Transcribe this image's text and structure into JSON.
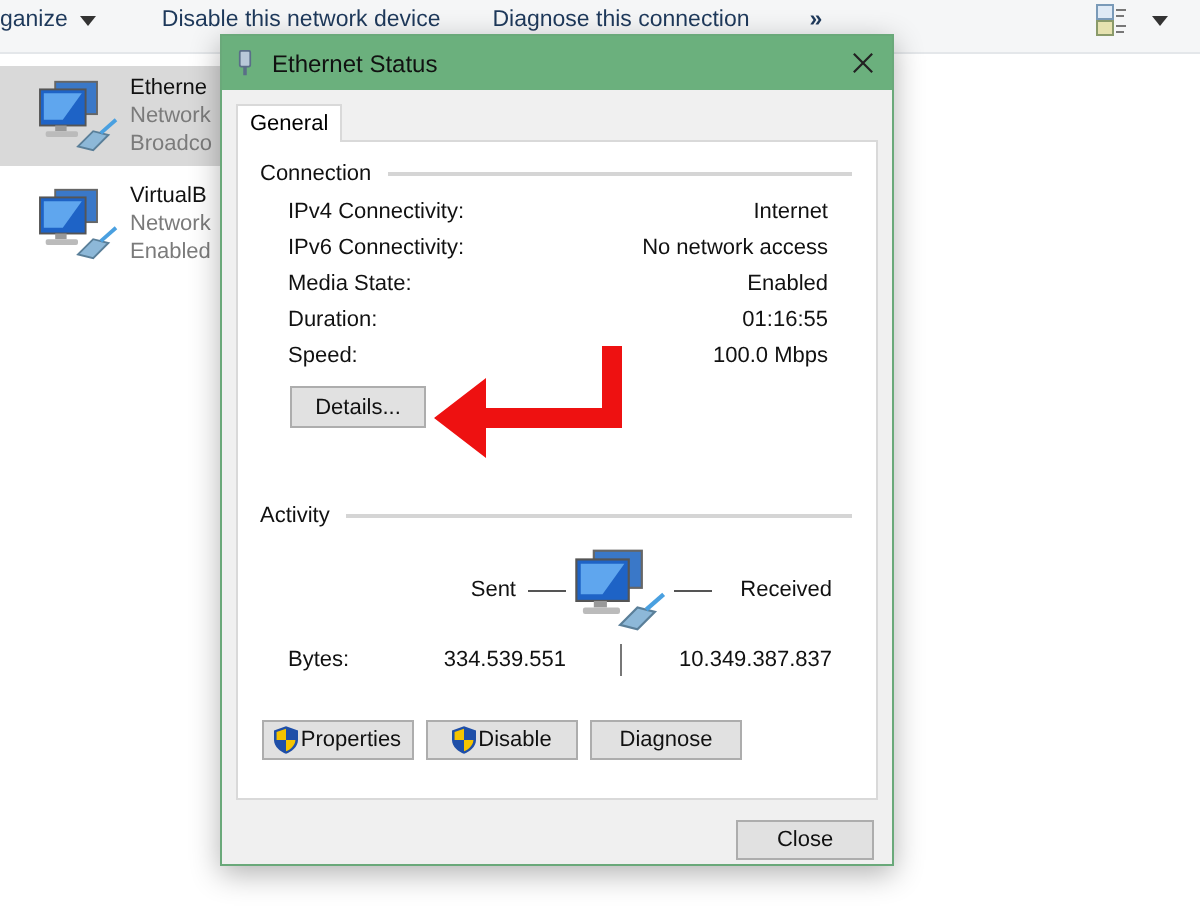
{
  "explorer": {
    "toolbar": {
      "organize": "ganize",
      "actions": [
        "Disable this network device",
        "Diagnose this connection"
      ],
      "more": "»"
    },
    "connections": [
      {
        "name": "Etherne",
        "status": "Network",
        "adapter": "Broadco",
        "selected": true
      },
      {
        "name": "VirtualB",
        "status": "Network",
        "adapter": "Enabled",
        "selected": false
      }
    ]
  },
  "dialog": {
    "title": "Ethernet Status",
    "tabs": [
      {
        "label": "General",
        "selected": true
      }
    ],
    "connection": {
      "heading": "Connection",
      "rows": [
        {
          "label": "IPv4 Connectivity:",
          "value": "Internet"
        },
        {
          "label": "IPv6 Connectivity:",
          "value": "No network access"
        },
        {
          "label": "Media State:",
          "value": "Enabled"
        },
        {
          "label": "Duration:",
          "value": "01:16:55"
        },
        {
          "label": "Speed:",
          "value": "100.0 Mbps"
        }
      ],
      "details_button": "Details..."
    },
    "activity": {
      "heading": "Activity",
      "sent_label": "Sent",
      "received_label": "Received",
      "bytes_label": "Bytes:",
      "sent": "334.539.551",
      "received": "10.349.387.837"
    },
    "buttons": [
      {
        "label": "Properties",
        "shield": true
      },
      {
        "label": "Disable",
        "shield": true
      },
      {
        "label": "Diagnose",
        "shield": false
      }
    ],
    "close_button": "Close"
  }
}
